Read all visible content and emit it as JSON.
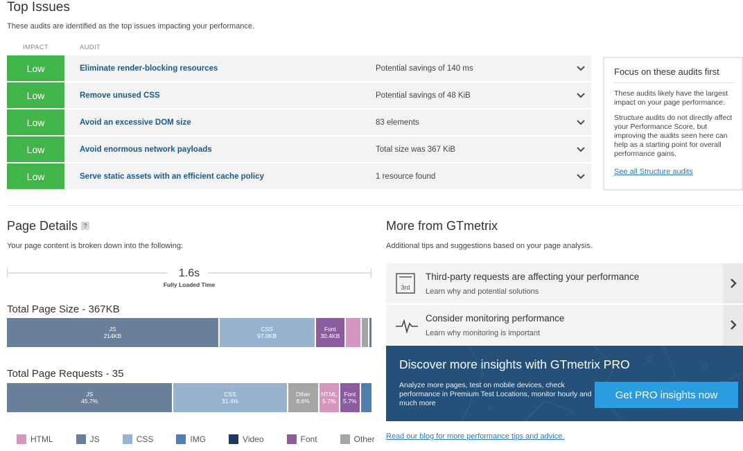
{
  "top_issues": {
    "title": "Top Issues",
    "subtitle": "These audits are identified as the top issues impacting your performance.",
    "col_impact": "IMPACT",
    "col_audit": "AUDIT",
    "rows": [
      {
        "impact": "Low",
        "audit": "Eliminate render-blocking resources",
        "meta": "Potential savings of 140 ms"
      },
      {
        "impact": "Low",
        "audit": "Remove unused CSS",
        "meta": "Potential savings of 48 KiB"
      },
      {
        "impact": "Low",
        "audit": "Avoid an excessive DOM size",
        "meta": "83 elements"
      },
      {
        "impact": "Low",
        "audit": "Avoid enormous network payloads",
        "meta": "Total size was 367 KiB"
      },
      {
        "impact": "Low",
        "audit": "Serve static assets with an efficient cache policy",
        "meta": "1 resource found"
      }
    ],
    "impact_color": "#41b549"
  },
  "focus_box": {
    "title": "Focus on these audits first",
    "p1": "These audits likely have the largest impact on your page performance.",
    "p2": "Structure audits do not directly affect your Performance Score, but improving the audits seen here can help as a starting point for overall performance gains.",
    "link": "See all Structure audits"
  },
  "page_details": {
    "title": "Page Details",
    "help": "?",
    "subtitle": "Your page content is broken down into the following:",
    "fully_loaded_value": "1.6s",
    "fully_loaded_label": "Fully Loaded Time",
    "size_title": "Total Page Size - 367KB",
    "size_segments": [
      {
        "type": "JS",
        "label": "JS",
        "value": "214KB",
        "share": 58.3,
        "color": "#6a7f99"
      },
      {
        "type": "CSS",
        "label": "CSS",
        "value": "97.0KB",
        "share": 26.4,
        "color": "#97b3cf"
      },
      {
        "type": "Font",
        "label": "Font",
        "value": "30.4KB",
        "share": 8.3,
        "color": "#8c5d9e"
      },
      {
        "type": "HTML",
        "label": "",
        "value": "",
        "share": 4.4,
        "color": "#d796c0"
      },
      {
        "type": "Other",
        "label": "",
        "value": "",
        "share": 2.0,
        "color": "#a5a5a5"
      },
      {
        "type": "IMG",
        "label": "",
        "value": "",
        "share": 0.6,
        "color": "#4f7fb0"
      }
    ],
    "requests_title": "Total Page Requests - 35",
    "request_segments": [
      {
        "type": "JS",
        "label": "JS",
        "value": "45.7%",
        "share": 45.7,
        "color": "#6a7f99"
      },
      {
        "type": "CSS",
        "label": "CSS",
        "value": "31.4%",
        "share": 31.4,
        "color": "#97b3cf"
      },
      {
        "type": "Other",
        "label": "Other",
        "value": "8.6%",
        "share": 8.6,
        "color": "#a5a5a5"
      },
      {
        "type": "HTML",
        "label": "HTML",
        "value": "5.7%",
        "share": 5.7,
        "color": "#d796c0"
      },
      {
        "type": "Font",
        "label": "Font",
        "value": "5.7%",
        "share": 5.7,
        "color": "#8c5d9e"
      },
      {
        "type": "IMG",
        "label": "",
        "value": "",
        "share": 2.9,
        "color": "#4f7fb0"
      }
    ],
    "legend": [
      {
        "label": "HTML",
        "color": "#d796c0"
      },
      {
        "label": "JS",
        "color": "#6a7f99"
      },
      {
        "label": "CSS",
        "color": "#97b3cf"
      },
      {
        "label": "IMG",
        "color": "#4f7fb0"
      },
      {
        "label": "Video",
        "color": "#1d3a5c"
      },
      {
        "label": "Font",
        "color": "#8c5d9e"
      },
      {
        "label": "Other",
        "color": "#a5a5a5"
      }
    ]
  },
  "more": {
    "title": "More from GTmetrix",
    "subtitle": "Additional tips and suggestions based on your page analysis.",
    "tips": [
      {
        "icon": "third-party-icon",
        "icon_text": "3rd",
        "title": "Third-party requests are affecting your performance",
        "sub": "Learn why and potential solutions"
      },
      {
        "icon": "heartbeat-icon",
        "icon_text": "",
        "title": "Consider monitoring performance",
        "sub": "Learn why monitoring is important"
      }
    ],
    "pro": {
      "title": "Discover more insights with GTmetrix PRO",
      "text": "Analyze more pages, test on mobile devices, check performance in Premium Test Locations, monitor hourly and much more",
      "button": "Get PRO insights now"
    },
    "blog_link": "Read our blog for more performance tips and advice."
  }
}
